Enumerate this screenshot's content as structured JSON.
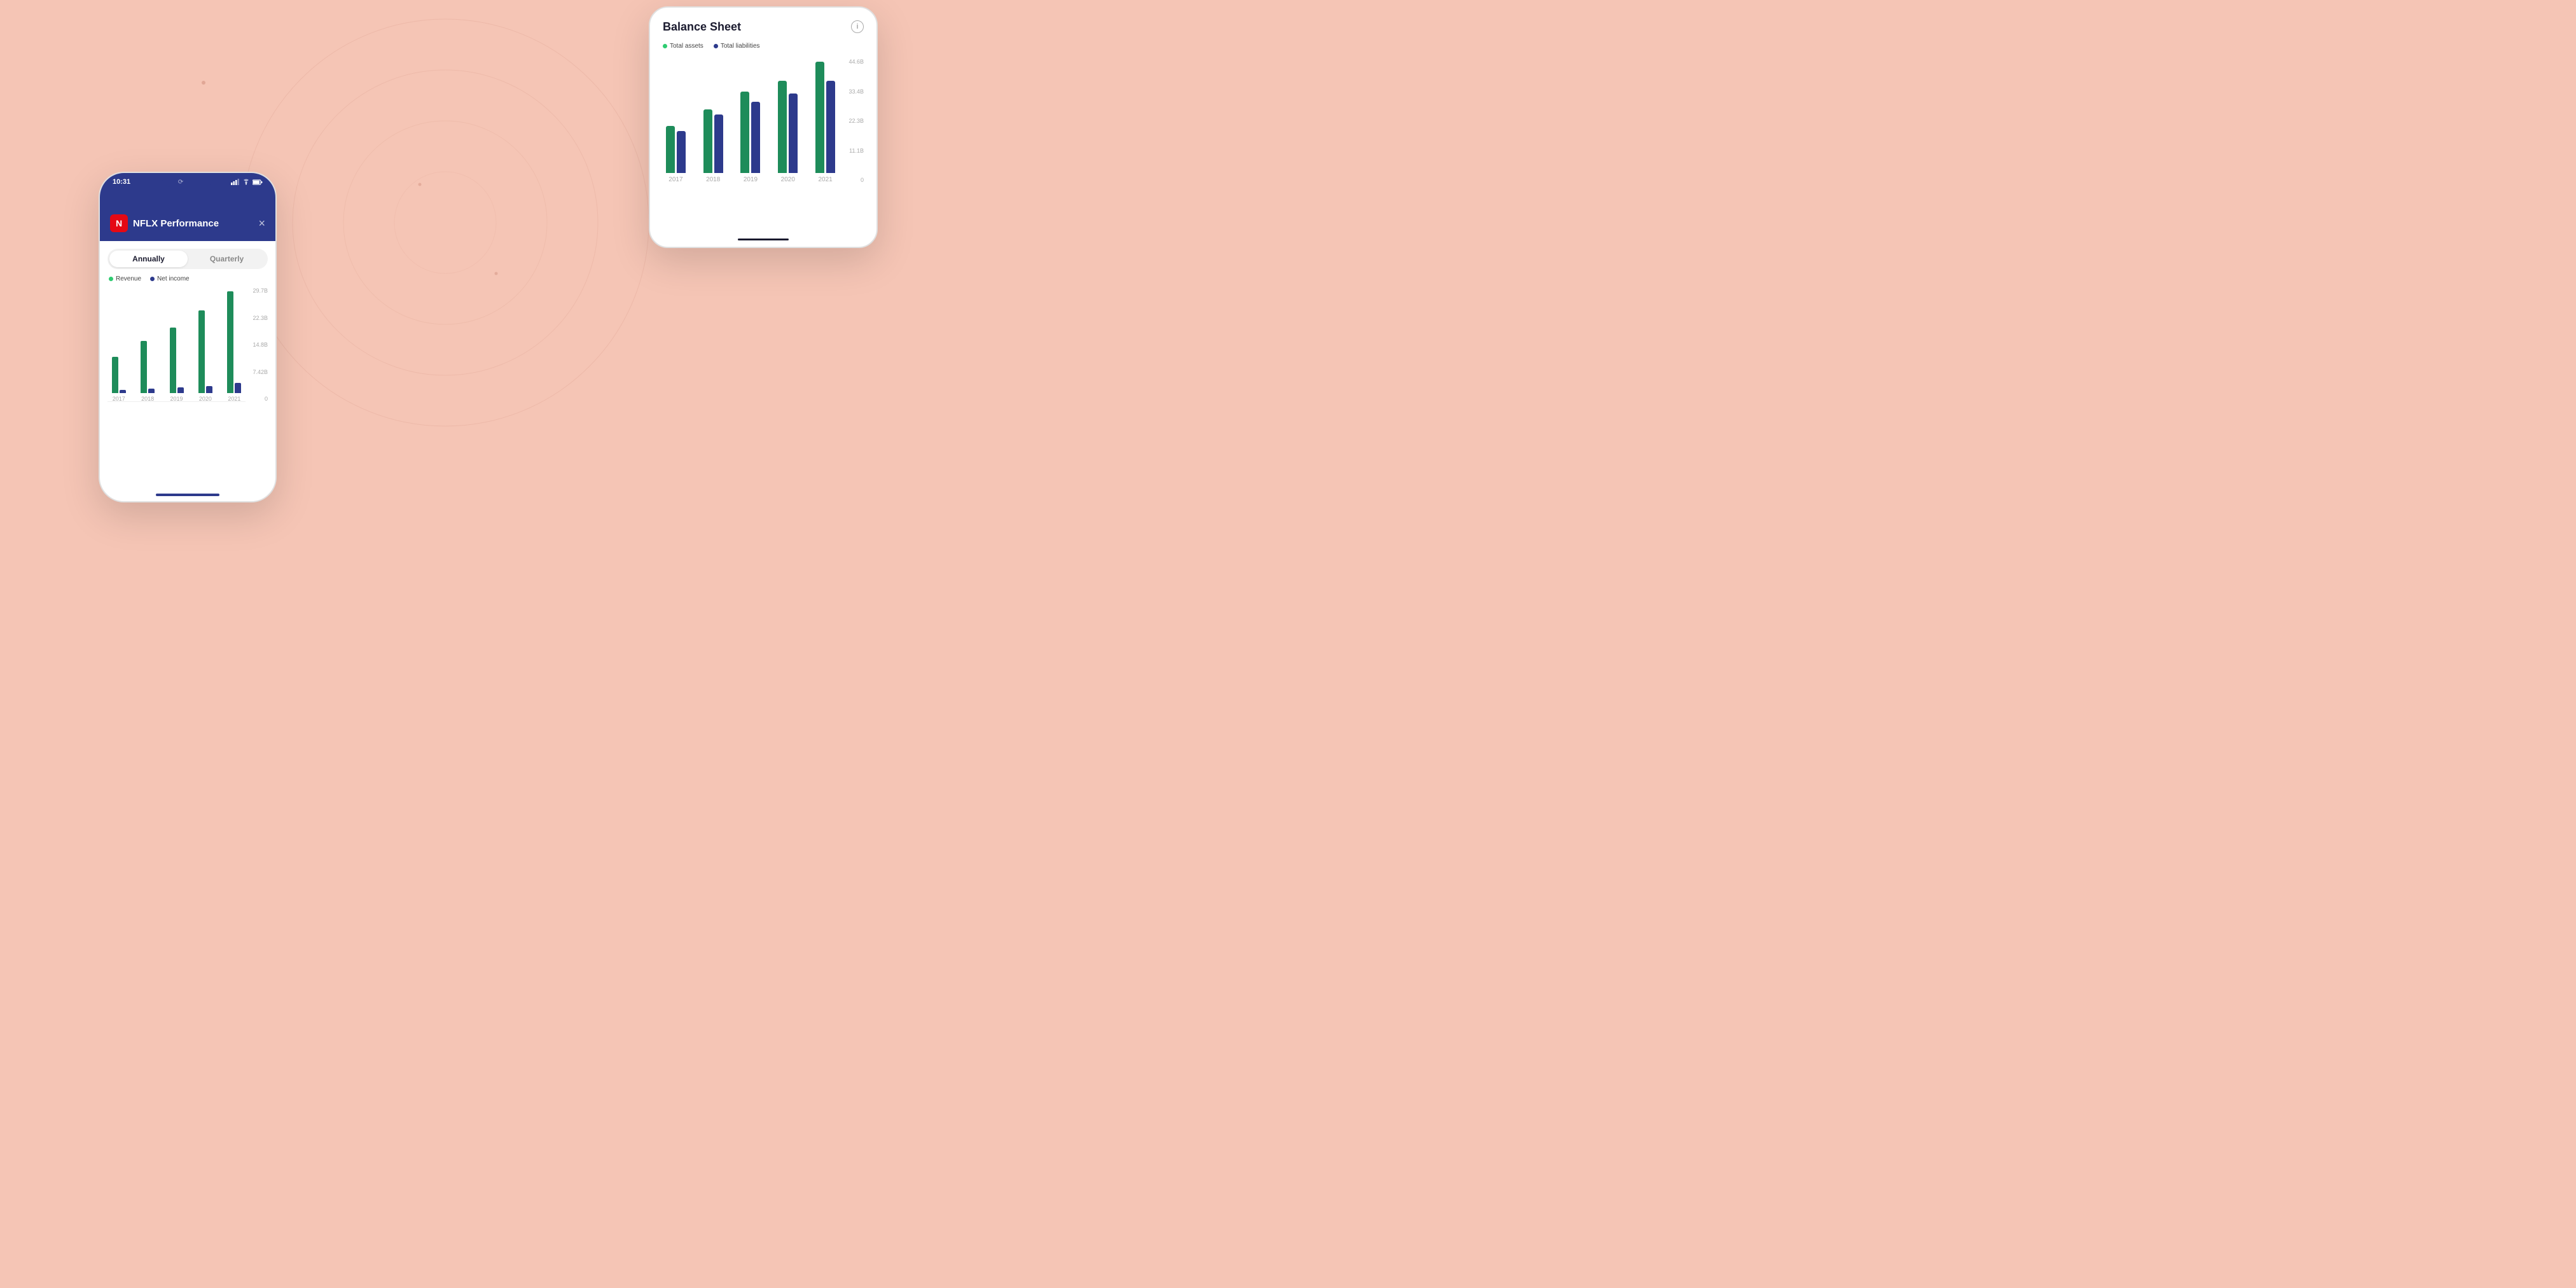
{
  "background": {
    "color": "#f5c5b5"
  },
  "phone_left": {
    "status": {
      "time": "10:31",
      "icons": [
        "signal",
        "wifi",
        "battery"
      ]
    },
    "header": {
      "logo_letter": "N",
      "title": "NFLX Performance",
      "close_label": "×"
    },
    "tabs": {
      "active": "Annually",
      "inactive": "Quarterly"
    },
    "legend": {
      "items": [
        {
          "label": "Revenue",
          "color": "green"
        },
        {
          "label": "Net income",
          "color": "blue"
        }
      ]
    },
    "chart": {
      "y_labels": [
        "29.7B",
        "22.3B",
        "14.8B",
        "7.42B",
        "0"
      ],
      "bars": [
        {
          "year": "2017",
          "revenue_pct": 32,
          "net_income_pct": 3
        },
        {
          "year": "2018",
          "revenue_pct": 46,
          "net_income_pct": 4
        },
        {
          "year": "2019",
          "revenue_pct": 57,
          "net_income_pct": 5
        },
        {
          "year": "2020",
          "revenue_pct": 72,
          "net_income_pct": 6
        },
        {
          "year": "2021",
          "revenue_pct": 90,
          "net_income_pct": 9
        }
      ]
    }
  },
  "phone_right": {
    "title": "Balance Sheet",
    "info_icon": "i",
    "legend": {
      "items": [
        {
          "label": "Total assets",
          "color": "green"
        },
        {
          "label": "Total liabilities",
          "color": "blue"
        }
      ]
    },
    "chart": {
      "y_labels": [
        "44.6B",
        "33.4B",
        "22.3B",
        "11.1B",
        "0"
      ],
      "bars": [
        {
          "year": "2017",
          "assets_pct": 38,
          "liabilities_pct": 34
        },
        {
          "year": "2018",
          "assets_pct": 52,
          "liabilities_pct": 48
        },
        {
          "year": "2019",
          "assets_pct": 66,
          "liabilities_pct": 58
        },
        {
          "year": "2020",
          "assets_pct": 74,
          "liabilities_pct": 65
        },
        {
          "year": "2021",
          "assets_pct": 90,
          "liabilities_pct": 75
        }
      ]
    }
  }
}
